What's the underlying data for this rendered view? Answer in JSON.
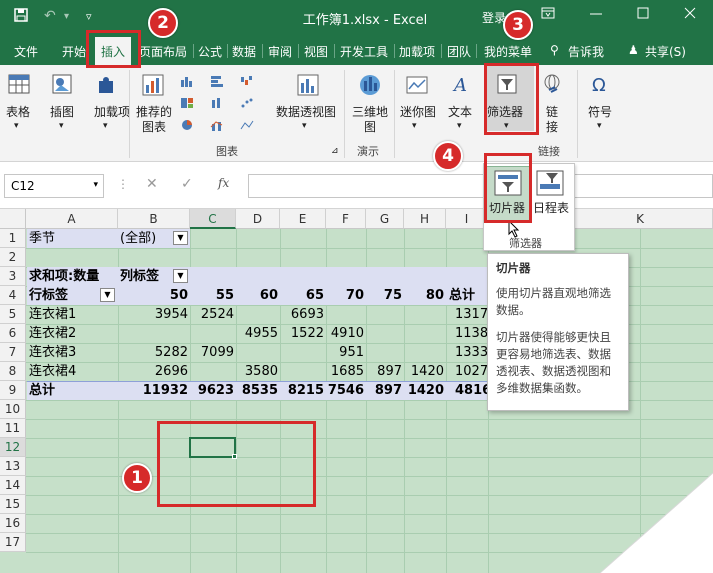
{
  "titlebar": {
    "title": "工作簿1.xlsx  -  Excel",
    "login": "登录"
  },
  "tabs": [
    "文件",
    "开始",
    "插入",
    "页面布局",
    "公式",
    "数据",
    "审阅",
    "视图",
    "开发工具",
    "加载项",
    "团队",
    "我的菜单"
  ],
  "tell_me": "告诉我",
  "share": "共享(S)",
  "ribbon": {
    "table": "表格",
    "illustrations": "插图",
    "addins": "加载项",
    "recommended_charts": "推荐的\n图表",
    "pivotchart": "数据透视图",
    "charts_group": "图表",
    "map3d": "三维地\n图",
    "tours_group": "演示",
    "sparklines": "迷你图",
    "text": "文本",
    "filters": "筛选器",
    "link": "链\n接",
    "links_group": "链接",
    "symbols": "符号"
  },
  "namebox": "C12",
  "fx": "fx",
  "columns": [
    "A",
    "B",
    "C",
    "D",
    "E",
    "F",
    "G",
    "H",
    "I",
    "K"
  ],
  "rows": [
    "1",
    "2",
    "3",
    "4",
    "5",
    "6",
    "7",
    "8",
    "9",
    "10",
    "11",
    "12",
    "13",
    "14",
    "15",
    "16",
    "17"
  ],
  "pivot": {
    "filter_label": "季节",
    "filter_value": "(全部)",
    "sum_label": "求和项:数量",
    "col_label": "列标签",
    "row_label": "行标签",
    "headers": [
      "50",
      "55",
      "60",
      "65",
      "70",
      "75",
      "80",
      "总计"
    ],
    "data": [
      {
        "name": "连衣裙1",
        "vals": [
          "3954",
          "2524",
          "",
          "6693",
          "",
          "",
          "",
          "1317"
        ]
      },
      {
        "name": "连衣裙2",
        "vals": [
          "",
          "",
          "4955",
          "1522",
          "4910",
          "",
          "",
          "1138"
        ]
      },
      {
        "name": "连衣裙3",
        "vals": [
          "5282",
          "7099",
          "",
          "",
          "951",
          "",
          "",
          "1333"
        ]
      },
      {
        "name": "连衣裙4",
        "vals": [
          "2696",
          "",
          "3580",
          "",
          "1685",
          "897",
          "1420",
          "1027"
        ]
      }
    ],
    "total_label": "总计",
    "totals": [
      "11932",
      "9623",
      "8535",
      "8215",
      "7546",
      "897",
      "1420",
      "4816"
    ]
  },
  "dropdown": {
    "slicer": "切片器",
    "timeline": "日程表",
    "filters": "筛选器"
  },
  "tooltip": {
    "title": "切片器",
    "p1": "使用切片器直观地筛选数据。",
    "p2": "切片器使得能够更快且更容易地筛选表、数据透视表、数据透视图和多维数据集函数。"
  },
  "badges": [
    "1",
    "2",
    "3",
    "4"
  ],
  "colors": {
    "accent": "#217346",
    "annotation": "#d62a2a",
    "grid": "#c6e0c9",
    "pivot_band": "#dcdff2"
  }
}
